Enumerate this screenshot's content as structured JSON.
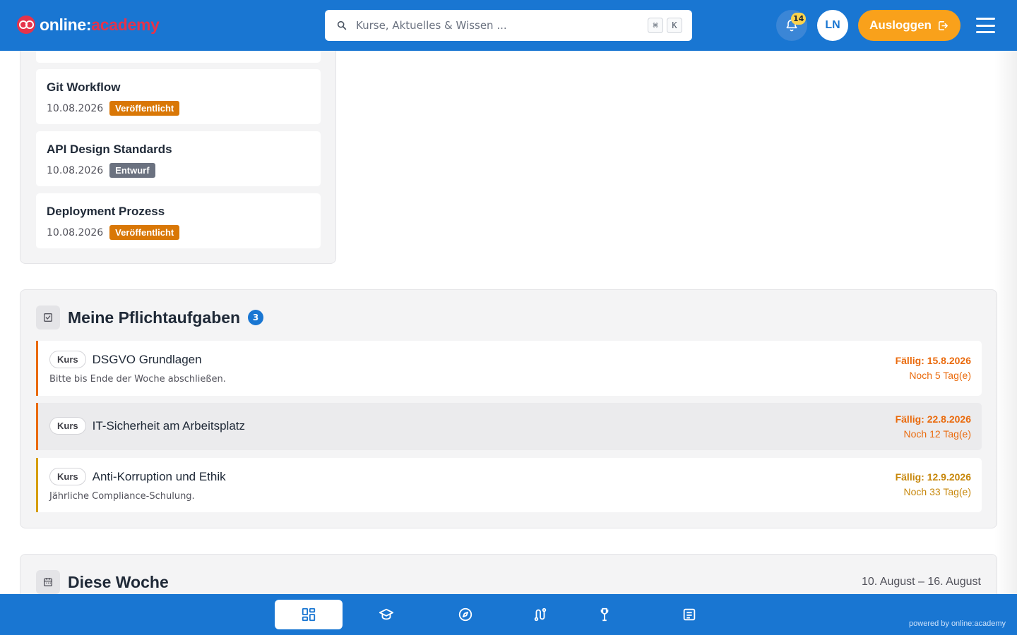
{
  "header": {
    "logo_part1": "online:",
    "logo_part2": "academy",
    "search_placeholder": "Kurse, Aktuelles & Wissen ...",
    "shortcut_key1": "⌘",
    "shortcut_key2": "K",
    "notification_count": "14",
    "avatar_initials": "LN",
    "logout_label": "Ausloggen"
  },
  "articles": [
    {
      "title": "Git Workflow",
      "date": "10.08.2026",
      "status": "Veröffentlicht"
    },
    {
      "title": "API Design Standards",
      "date": "10.08.2026",
      "status": "Entwurf"
    },
    {
      "title": "Deployment Prozess",
      "date": "10.08.2026",
      "status": "Veröffentlicht"
    }
  ],
  "tasks_section": {
    "title": "Meine Pflichtaufgaben",
    "count": "3",
    "items": [
      {
        "type": "Kurs",
        "title": "DSGVO Grundlagen",
        "description": "Bitte bis Ende der Woche abschließen.",
        "due": "Fällig: 15.8.2026",
        "remaining": "Noch 5 Tag(e)"
      },
      {
        "type": "Kurs",
        "title": "IT-Sicherheit am Arbeitsplatz",
        "description": "",
        "due": "Fällig: 22.8.2026",
        "remaining": "Noch 12 Tag(e)"
      },
      {
        "type": "Kurs",
        "title": "Anti-Korruption und Ethik",
        "description": "Jährliche Compliance-Schulung.",
        "due": "Fällig: 12.9.2026",
        "remaining": "Noch 33 Tag(e)"
      }
    ]
  },
  "week_section": {
    "title": "Diese Woche",
    "range": "10. August – 16. August"
  },
  "footer": {
    "powered_by": "powered by online:academy",
    "nav_icons": [
      "dashboard-icon",
      "graduation-cap-icon",
      "compass-icon",
      "path-icon",
      "trophy-icon",
      "article-icon"
    ]
  },
  "colors": {
    "primary": "#1976d2",
    "accent_orange": "#f9a11b",
    "published": "#d97706",
    "draft": "#6b7280",
    "due_urgent": "#ea6a0c",
    "due_later": "#c7870b"
  }
}
